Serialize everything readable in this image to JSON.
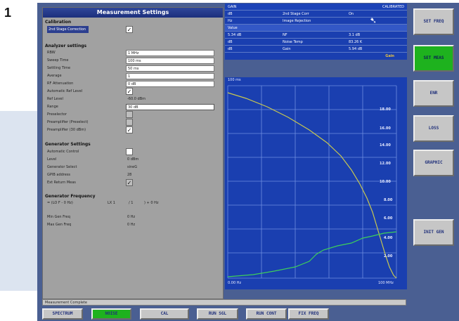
{
  "figure_number": "1",
  "panel": {
    "title": "Measurement Settings",
    "calibration": {
      "heading": "Calibration",
      "second_stage": "2nd Stage Correction",
      "second_stage_checked": true
    },
    "analyzer": {
      "heading": "Analyzer settings",
      "rows": [
        {
          "label": "RBW",
          "value": "1 MHz"
        },
        {
          "label": "Sweep Time",
          "value": "100 ms"
        },
        {
          "label": "Settling Time",
          "value": "50 ms"
        },
        {
          "label": "Average",
          "value": "1"
        },
        {
          "label": "RF Attenuation",
          "value": "0 dB"
        }
      ],
      "auto_ref": "Automatic Ref Level",
      "auto_ref_checked": true,
      "ref_level_label": "Ref Level",
      "ref_level_value": "-60.0 dBm",
      "range_label": "Range",
      "range_value": "30 dB",
      "preselector": "Preselector",
      "preamp_pres": "Preamplifier (Preselect)",
      "preamp_30": "Preamplifier (30 dBm)",
      "preamp_30_checked": true
    },
    "generator": {
      "heading": "Generator Settings",
      "auto_control": "Automatic Control",
      "level_label": "Level",
      "level_value": "0 dBm",
      "select_label": "Generator Select",
      "select_value": "sineG",
      "gpib_label": "GPIB address",
      "gpib_value": "28",
      "ext_ref_label": "Ext Return Meas",
      "ext_ref_checked": true
    },
    "gen_freq": {
      "heading": "Generator Frequency",
      "formula": "= (LO F - 0 Hz)",
      "f1": "LX  1",
      "f2": "/ 1",
      "f3": ") + 0 Hz",
      "min_label": "Min Gen Freq",
      "min_value": "0 Hz",
      "max_label": "Max Gen Freq",
      "max_value": "0 Hz"
    }
  },
  "table": {
    "header_left": "GAIN",
    "header_right": "CALIBRATED",
    "rows": [
      {
        "c1": "dB",
        "c2": "2nd Stage Corr",
        "c3": "On"
      },
      {
        "c1": "Hz",
        "c2": "Image Rejection",
        "c3": ""
      }
    ],
    "value_label": "Value",
    "value_rows": [
      {
        "c1": "5.34 dB",
        "c2": "NF",
        "c3": "3.1 dB"
      },
      {
        "c1": "dB",
        "c2": "Noise Temp",
        "c3": "83.26 K"
      },
      {
        "c1": "dB",
        "c2": "Gain",
        "c3": "5.94 dB"
      }
    ],
    "gain_label": "Gain"
  },
  "plot": {
    "top_left": "100 ms",
    "bottom_left": "0.00 Hz",
    "bottom_right": "100 MHz",
    "y_ticks": [
      "18.00",
      "16.00",
      "14.00",
      "12.00",
      "10.00",
      "8.00",
      "6.00",
      "4.00",
      "2.00"
    ]
  },
  "status": "Measurement Complete",
  "softkeys": [
    {
      "label": "SET FREQ",
      "active": false
    },
    {
      "label": "SET MEAS",
      "active": true
    },
    {
      "label": "ENR",
      "active": false
    },
    {
      "label": "LOSS",
      "active": false
    },
    {
      "label": "GRAPHIC",
      "active": false
    },
    {
      "label": "INIT GEN",
      "active": false
    }
  ],
  "hotkeys": [
    {
      "label": "SPECTRUM",
      "active": false
    },
    {
      "label": "NOISE",
      "active": true
    },
    {
      "label": "CAL",
      "active": false
    },
    {
      "label": "RUN SGL",
      "active": false
    },
    {
      "label": "RUN CONT",
      "active": false
    },
    {
      "label": "FIX FREQ",
      "active": false
    }
  ],
  "colors": {
    "frame": "#4a5f92",
    "panel_bg": "#a1a1a1",
    "title_bar": "#1c2f7c",
    "plot_bg": "#1a3fb0",
    "trace1": "#c8c850",
    "trace2": "#3ecf5a",
    "active_key": "#1eb21e"
  }
}
